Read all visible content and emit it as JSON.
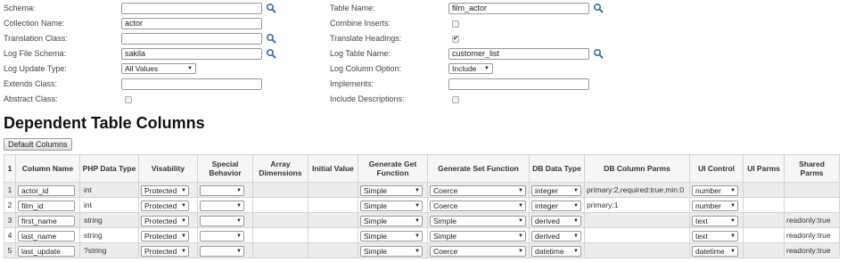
{
  "form": {
    "schema": {
      "label": "Schema:",
      "value": ""
    },
    "collection_name": {
      "label": "Collection Name:",
      "value": "actor"
    },
    "translation_class": {
      "label": "Translation Class:",
      "value": ""
    },
    "log_file_schema": {
      "label": "Log File Schema:",
      "value": "sakila"
    },
    "log_update_type": {
      "label": "Log Update Type:",
      "value": "All Values"
    },
    "extends_class": {
      "label": "Extends Class:",
      "value": ""
    },
    "abstract_class": {
      "label": "Abstract Class:",
      "checked": false
    },
    "table_name": {
      "label": "Table Name:",
      "value": "film_actor"
    },
    "combine_inserts": {
      "label": "Combine Inserts:",
      "checked": false
    },
    "translate_headings": {
      "label": "Translate Headings:",
      "checked": true
    },
    "log_table_name": {
      "label": "Log Table Name:",
      "value": "customer_list"
    },
    "log_column_option": {
      "label": "Log Column Option:",
      "value": "Include"
    },
    "implements": {
      "label": "Implements:",
      "value": ""
    },
    "include_descriptions": {
      "label": "Include Descriptions:",
      "checked": false
    }
  },
  "section_title": "Dependent Table Columns",
  "default_columns_button": "Default Columns",
  "table": {
    "headers": {
      "num": "1",
      "column_name": "Column Name",
      "php_type": "PHP Data Type",
      "visability": "Visability",
      "special_behavior": "Special Behavior",
      "array_dimensions": "Array Dimensions",
      "initial_value": "Initial Value",
      "generate_get": "Generate Get Function",
      "generate_set": "Generate Set Function",
      "db_type": "DB Data Type",
      "db_parms": "DB Column Parms",
      "ui_control": "UI Control",
      "ui_parms": "UI Parms",
      "shared_parms": "Shared Parms"
    },
    "rows": [
      {
        "num": "1",
        "column_name": "actor_id",
        "php_type": "int",
        "visability": "Protected",
        "special_behavior": "",
        "array_dimensions": "",
        "initial_value": "",
        "get": "Simple",
        "set": "Coerce",
        "db_type": "integer",
        "db_parms": "primary:2,required:true,min:0",
        "ui_control": "number",
        "ui_parms": "",
        "shared_parms": ""
      },
      {
        "num": "2",
        "column_name": "film_id",
        "php_type": "int",
        "visability": "Protected",
        "special_behavior": "",
        "array_dimensions": "",
        "initial_value": "",
        "get": "Simple",
        "set": "Coerce",
        "db_type": "integer",
        "db_parms": "primary:1",
        "ui_control": "number",
        "ui_parms": "",
        "shared_parms": ""
      },
      {
        "num": "3",
        "column_name": "first_name",
        "php_type": "string",
        "visability": "Protected",
        "special_behavior": "",
        "array_dimensions": "",
        "initial_value": "",
        "get": "Simple",
        "set": "Simple",
        "db_type": "derived",
        "db_parms": "",
        "ui_control": "text",
        "ui_parms": "",
        "shared_parms": "readonly:true"
      },
      {
        "num": "4",
        "column_name": "last_name",
        "php_type": "string",
        "visability": "Protected",
        "special_behavior": "",
        "array_dimensions": "",
        "initial_value": "",
        "get": "Simple",
        "set": "Simple",
        "db_type": "derived",
        "db_parms": "",
        "ui_control": "text",
        "ui_parms": "",
        "shared_parms": "readonly:true"
      },
      {
        "num": "5",
        "column_name": "last_update",
        "php_type": "?string",
        "visability": "Protected",
        "special_behavior": "",
        "array_dimensions": "",
        "initial_value": "",
        "get": "Simple",
        "set": "Coerce",
        "db_type": "datetime",
        "db_parms": "",
        "ui_control": "datetime",
        "ui_parms": "",
        "shared_parms": "readonly:true"
      }
    ]
  },
  "icons": {
    "lookup": "magnifier-icon",
    "dropdown": "caret-down-icon",
    "checkmark": "checkmark-icon"
  }
}
